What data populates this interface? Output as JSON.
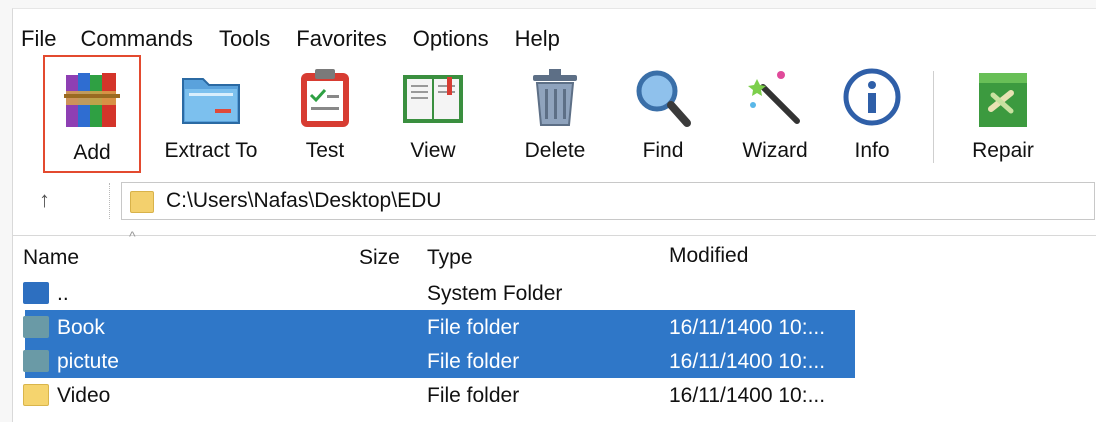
{
  "menu": [
    "File",
    "Commands",
    "Tools",
    "Favorites",
    "Options",
    "Help"
  ],
  "toolbar": {
    "add": "Add",
    "extract_to": "Extract To",
    "test": "Test",
    "view": "View",
    "delete": "Delete",
    "find": "Find",
    "wizard": "Wizard",
    "info": "Info",
    "repair": "Repair"
  },
  "address": {
    "up": "↑",
    "path": "C:\\Users\\Nafas\\Desktop\\EDU"
  },
  "columns": {
    "name": "Name",
    "size": "Size",
    "type": "Type",
    "modified": "Modified",
    "sort_caret": "^"
  },
  "rows": [
    {
      "name": "..",
      "type": "System Folder",
      "modified": "",
      "selected": false,
      "icon": "system-folder-icon"
    },
    {
      "name": "Book",
      "type": "File folder",
      "modified": "16/11/1400 10:...",
      "selected": true,
      "icon": "folder-icon"
    },
    {
      "name": "pictute",
      "type": "File folder",
      "modified": "16/11/1400 10:...",
      "selected": true,
      "icon": "folder-icon"
    },
    {
      "name": "Video",
      "type": "File folder",
      "modified": "16/11/1400 10:...",
      "selected": false,
      "icon": "folder-icon"
    }
  ],
  "colors": {
    "selection": "#2f77c8",
    "highlight_border": "#e34a2f"
  }
}
